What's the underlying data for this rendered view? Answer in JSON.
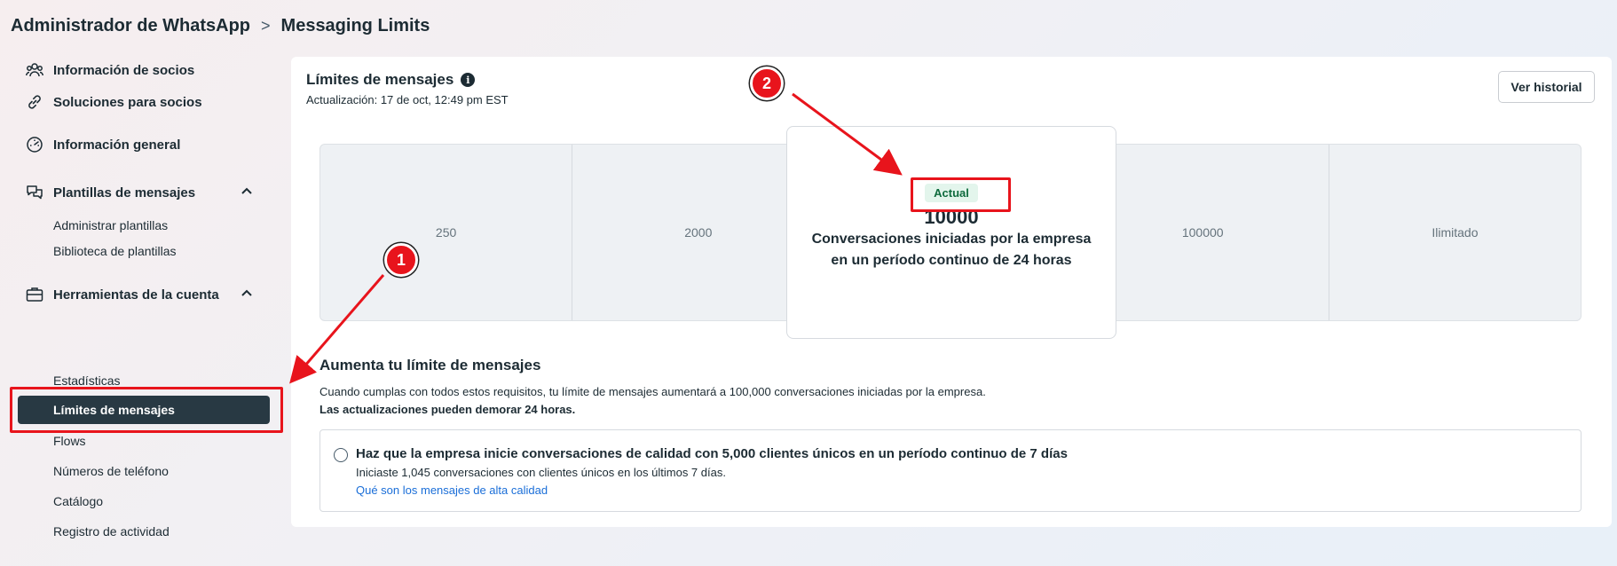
{
  "breadcrumb": {
    "root": "Administrador de WhatsApp",
    "separator": ">",
    "current": "Messaging Limits"
  },
  "sidebar": {
    "sections": [
      {
        "label": "Información de socios",
        "icon": "people-icon"
      },
      {
        "label": "Soluciones para socios",
        "icon": "link-icon"
      },
      {
        "label": "Información general",
        "icon": "gauge-icon"
      },
      {
        "label": "Plantillas de mensajes",
        "icon": "chat-bubbles-icon",
        "expanded": true,
        "items": [
          "Administrar plantillas",
          "Biblioteca de plantillas"
        ]
      },
      {
        "label": "Herramientas de la cuenta",
        "icon": "briefcase-icon",
        "expanded": true,
        "items": [
          "Estadísticas",
          "Límites de mensajes",
          "Flows",
          "Números de teléfono",
          "Catálogo",
          "Registro de actividad"
        ]
      }
    ],
    "active_item": "Límites de mensajes"
  },
  "card": {
    "title": "Límites de mensajes",
    "updated": "Actualización: 17 de oct, 12:49 pm EST",
    "history_button": "Ver historial"
  },
  "tiers": {
    "values": [
      "250",
      "2000",
      "10000",
      "100000",
      "Ilimitado"
    ],
    "current_index": 2,
    "current_badge": "Actual",
    "current_value": "10000",
    "current_description": "Conversaciones iniciadas por la empresa en un período continuo de 24 horas"
  },
  "increase": {
    "title": "Aumenta tu límite de mensajes",
    "description": "Cuando cumplas con todos estos requisitos, tu límite de mensajes aumentará a 100,000 conversaciones iniciadas por la empresa.",
    "note": "Las actualizaciones pueden demorar 24 horas.",
    "requirement": {
      "title": "Haz que la empresa inicie conversaciones de calidad con 5,000 clientes únicos en un período continuo de 7 días",
      "status": "Iniciaste 1,045 conversaciones con clientes únicos en los últimos 7 días.",
      "link": "Qué son los mensajes de alta calidad"
    }
  },
  "annotations": {
    "marker_1": "1",
    "marker_2": "2",
    "color": "#e8141c"
  }
}
